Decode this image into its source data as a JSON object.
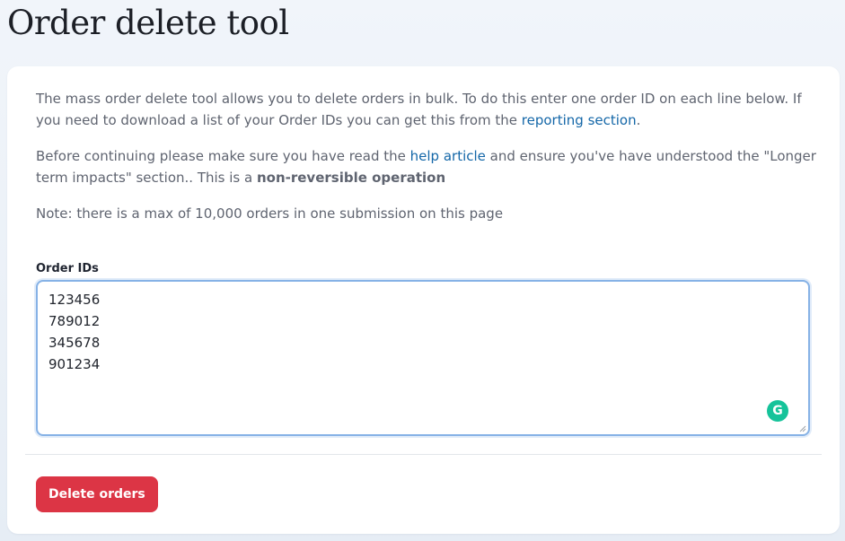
{
  "page": {
    "title": "Order delete tool"
  },
  "intro": {
    "p1_text": "The mass order delete tool allows you to delete orders in bulk. To do this enter one order ID on each line below. If you need to download a list of your Order IDs you can get this from the ",
    "p1_link": "reporting section",
    "p1_end": ".",
    "p2_text": "Before continuing please make sure you have read the ",
    "p2_link": "help article",
    "p2_mid": " and ensure you've have understood the \"Longer term impacts\" section.. This is a ",
    "p2_bold": "non-reversible operation",
    "p3_text": "Note: there is a max of 10,000 orders in one submission on this page"
  },
  "form": {
    "label": "Order IDs",
    "value": "123456\n789012\n345678\n901234",
    "grammarly_icon": "G"
  },
  "actions": {
    "delete_label": "Delete orders"
  },
  "colors": {
    "accent_link": "#1467a8",
    "danger": "#dc3545",
    "focus_border": "#86b2e6",
    "grammarly": "#15c39a"
  }
}
